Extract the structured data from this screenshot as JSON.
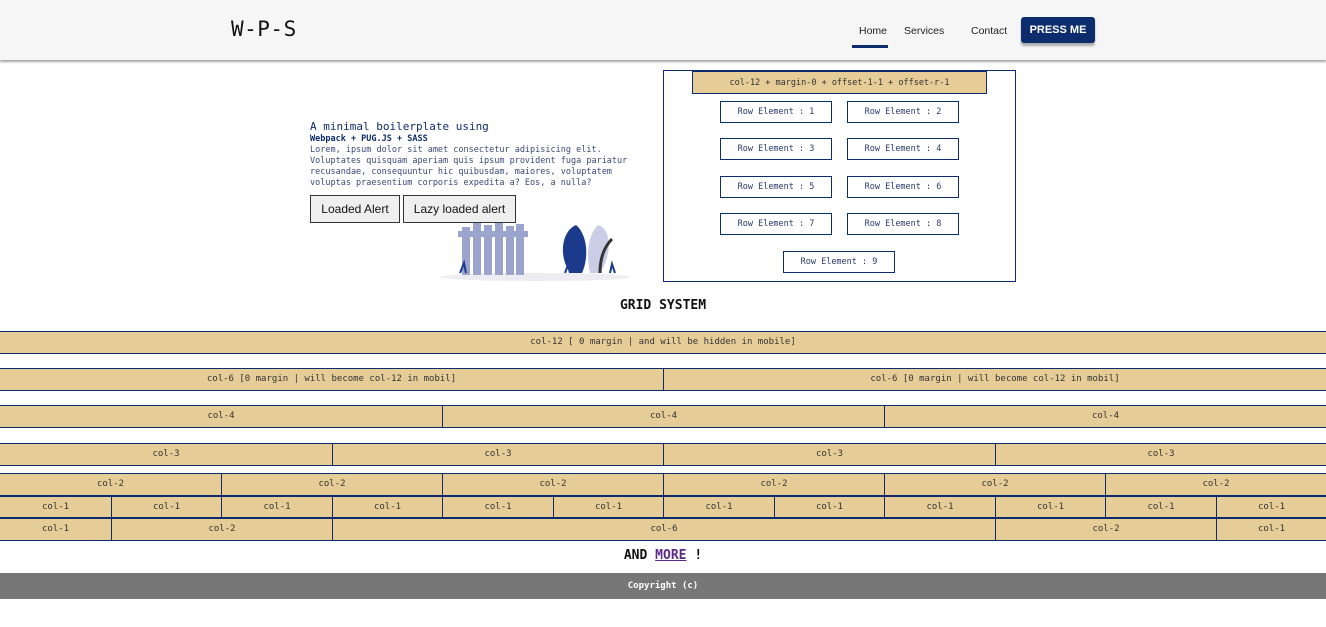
{
  "header": {
    "logo": "W-P-S",
    "nav": [
      {
        "label": "Home",
        "active": true
      },
      {
        "label": "Services",
        "active": false
      },
      {
        "label": "Contact",
        "active": false
      }
    ],
    "press_button": "PRESS ME"
  },
  "hero": {
    "title": "A minimal boilerplate using",
    "subtitle": "Webpack + PUG.JS + SASS",
    "description": "Lorem, ipsum dolor sit amet consectetur adipisicing elit. Voluptates quisquam aperiam quis ipsum provident fuga pariatur recusandae, consequuntur hic quibusdam, maiores, voluptatem voluptas praesentium corporis expedita a? Eos, a nulla?",
    "buttons": {
      "loaded": "Loaded Alert",
      "lazy": "Lazy loaded alert"
    }
  },
  "demo": {
    "header": "col-12 + margin-0 + offset-1-1 + offset-r-1",
    "elements": [
      "Row Element : 1",
      "Row Element : 2",
      "Row Element : 3",
      "Row Element : 4",
      "Row Element : 5",
      "Row Element : 6",
      "Row Element : 7",
      "Row Element : 8",
      "Row Element : 9"
    ]
  },
  "grid": {
    "title": "GRID SYSTEM",
    "rows": [
      [
        "col-12 [ 0 margin | and will be hidden in mobile]"
      ],
      [
        "col-6 [0 margin | will become col-12 in mobil]",
        "col-6 [0 margin | will become col-12 in mobil]"
      ],
      [
        "col-4",
        "col-4",
        "col-4"
      ],
      [
        "col-3",
        "col-3",
        "col-3",
        "col-3"
      ],
      [
        "col-2",
        "col-2",
        "col-2",
        "col-2",
        "col-2",
        "col-2"
      ],
      [
        "col-1",
        "col-1",
        "col-1",
        "col-1",
        "col-1",
        "col-1",
        "col-1",
        "col-1",
        "col-1",
        "col-1",
        "col-1",
        "col-1"
      ],
      [
        "col-1",
        "col-2",
        "col-6",
        "col-2",
        "col-1"
      ]
    ]
  },
  "and_more": {
    "prefix": "AND",
    "link": "MORE",
    "suffix": "!"
  },
  "footer": "Copyright (c)",
  "colors": {
    "primary": "#0d2c6e",
    "cell": "#e6cc96",
    "footer": "#777777"
  }
}
